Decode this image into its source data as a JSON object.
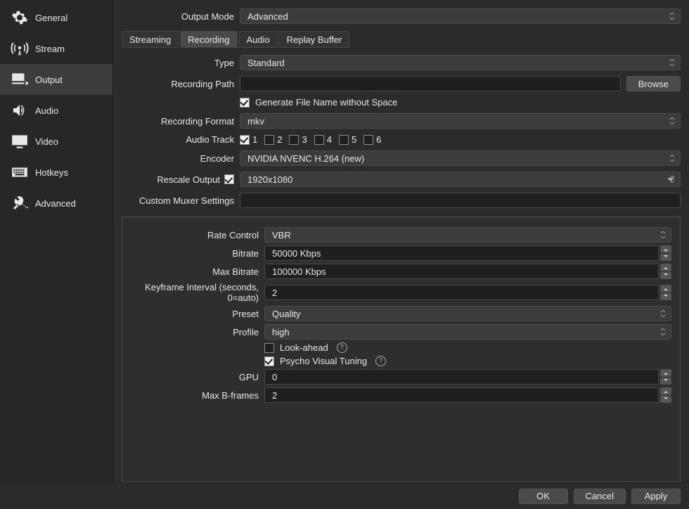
{
  "sidebar": {
    "items": [
      {
        "label": "General",
        "icon": "gear-icon"
      },
      {
        "label": "Stream",
        "icon": "antenna-icon"
      },
      {
        "label": "Output",
        "icon": "monitor-arrow-icon"
      },
      {
        "label": "Audio",
        "icon": "speaker-icon"
      },
      {
        "label": "Video",
        "icon": "display-icon"
      },
      {
        "label": "Hotkeys",
        "icon": "keyboard-icon"
      },
      {
        "label": "Advanced",
        "icon": "tools-icon"
      }
    ],
    "active_index": 2
  },
  "output_mode": {
    "label": "Output Mode",
    "value": "Advanced"
  },
  "tabs": {
    "items": [
      "Streaming",
      "Recording",
      "Audio",
      "Replay Buffer"
    ],
    "active_index": 1
  },
  "recording": {
    "type": {
      "label": "Type",
      "value": "Standard"
    },
    "path": {
      "label": "Recording Path",
      "value": "",
      "browse": "Browse"
    },
    "gen_name": {
      "label": "Generate File Name without Space",
      "checked": true
    },
    "format": {
      "label": "Recording Format",
      "value": "mkv"
    },
    "audio_track": {
      "label": "Audio Track",
      "tracks": [
        {
          "n": "1",
          "on": true
        },
        {
          "n": "2",
          "on": false
        },
        {
          "n": "3",
          "on": false
        },
        {
          "n": "4",
          "on": false
        },
        {
          "n": "5",
          "on": false
        },
        {
          "n": "6",
          "on": false
        }
      ]
    },
    "encoder": {
      "label": "Encoder",
      "value": "NVIDIA NVENC H.264 (new)"
    },
    "rescale": {
      "label": "Rescale Output",
      "checked": true,
      "value": "1920x1080"
    },
    "muxer": {
      "label": "Custom Muxer Settings",
      "value": ""
    }
  },
  "encoder": {
    "rate_control": {
      "label": "Rate Control",
      "value": "VBR"
    },
    "bitrate": {
      "label": "Bitrate",
      "value": "50000 Kbps"
    },
    "max_bitrate": {
      "label": "Max Bitrate",
      "value": "100000 Kbps"
    },
    "keyframe": {
      "label": "Keyframe Interval (seconds, 0=auto)",
      "value": "2"
    },
    "preset": {
      "label": "Preset",
      "value": "Quality"
    },
    "profile": {
      "label": "Profile",
      "value": "high"
    },
    "lookahead": {
      "label": "Look-ahead",
      "checked": false
    },
    "psycho": {
      "label": "Psycho Visual Tuning",
      "checked": true
    },
    "gpu": {
      "label": "GPU",
      "value": "0"
    },
    "bframes": {
      "label": "Max B-frames",
      "value": "2"
    }
  },
  "footer": {
    "ok": "OK",
    "cancel": "Cancel",
    "apply": "Apply"
  }
}
